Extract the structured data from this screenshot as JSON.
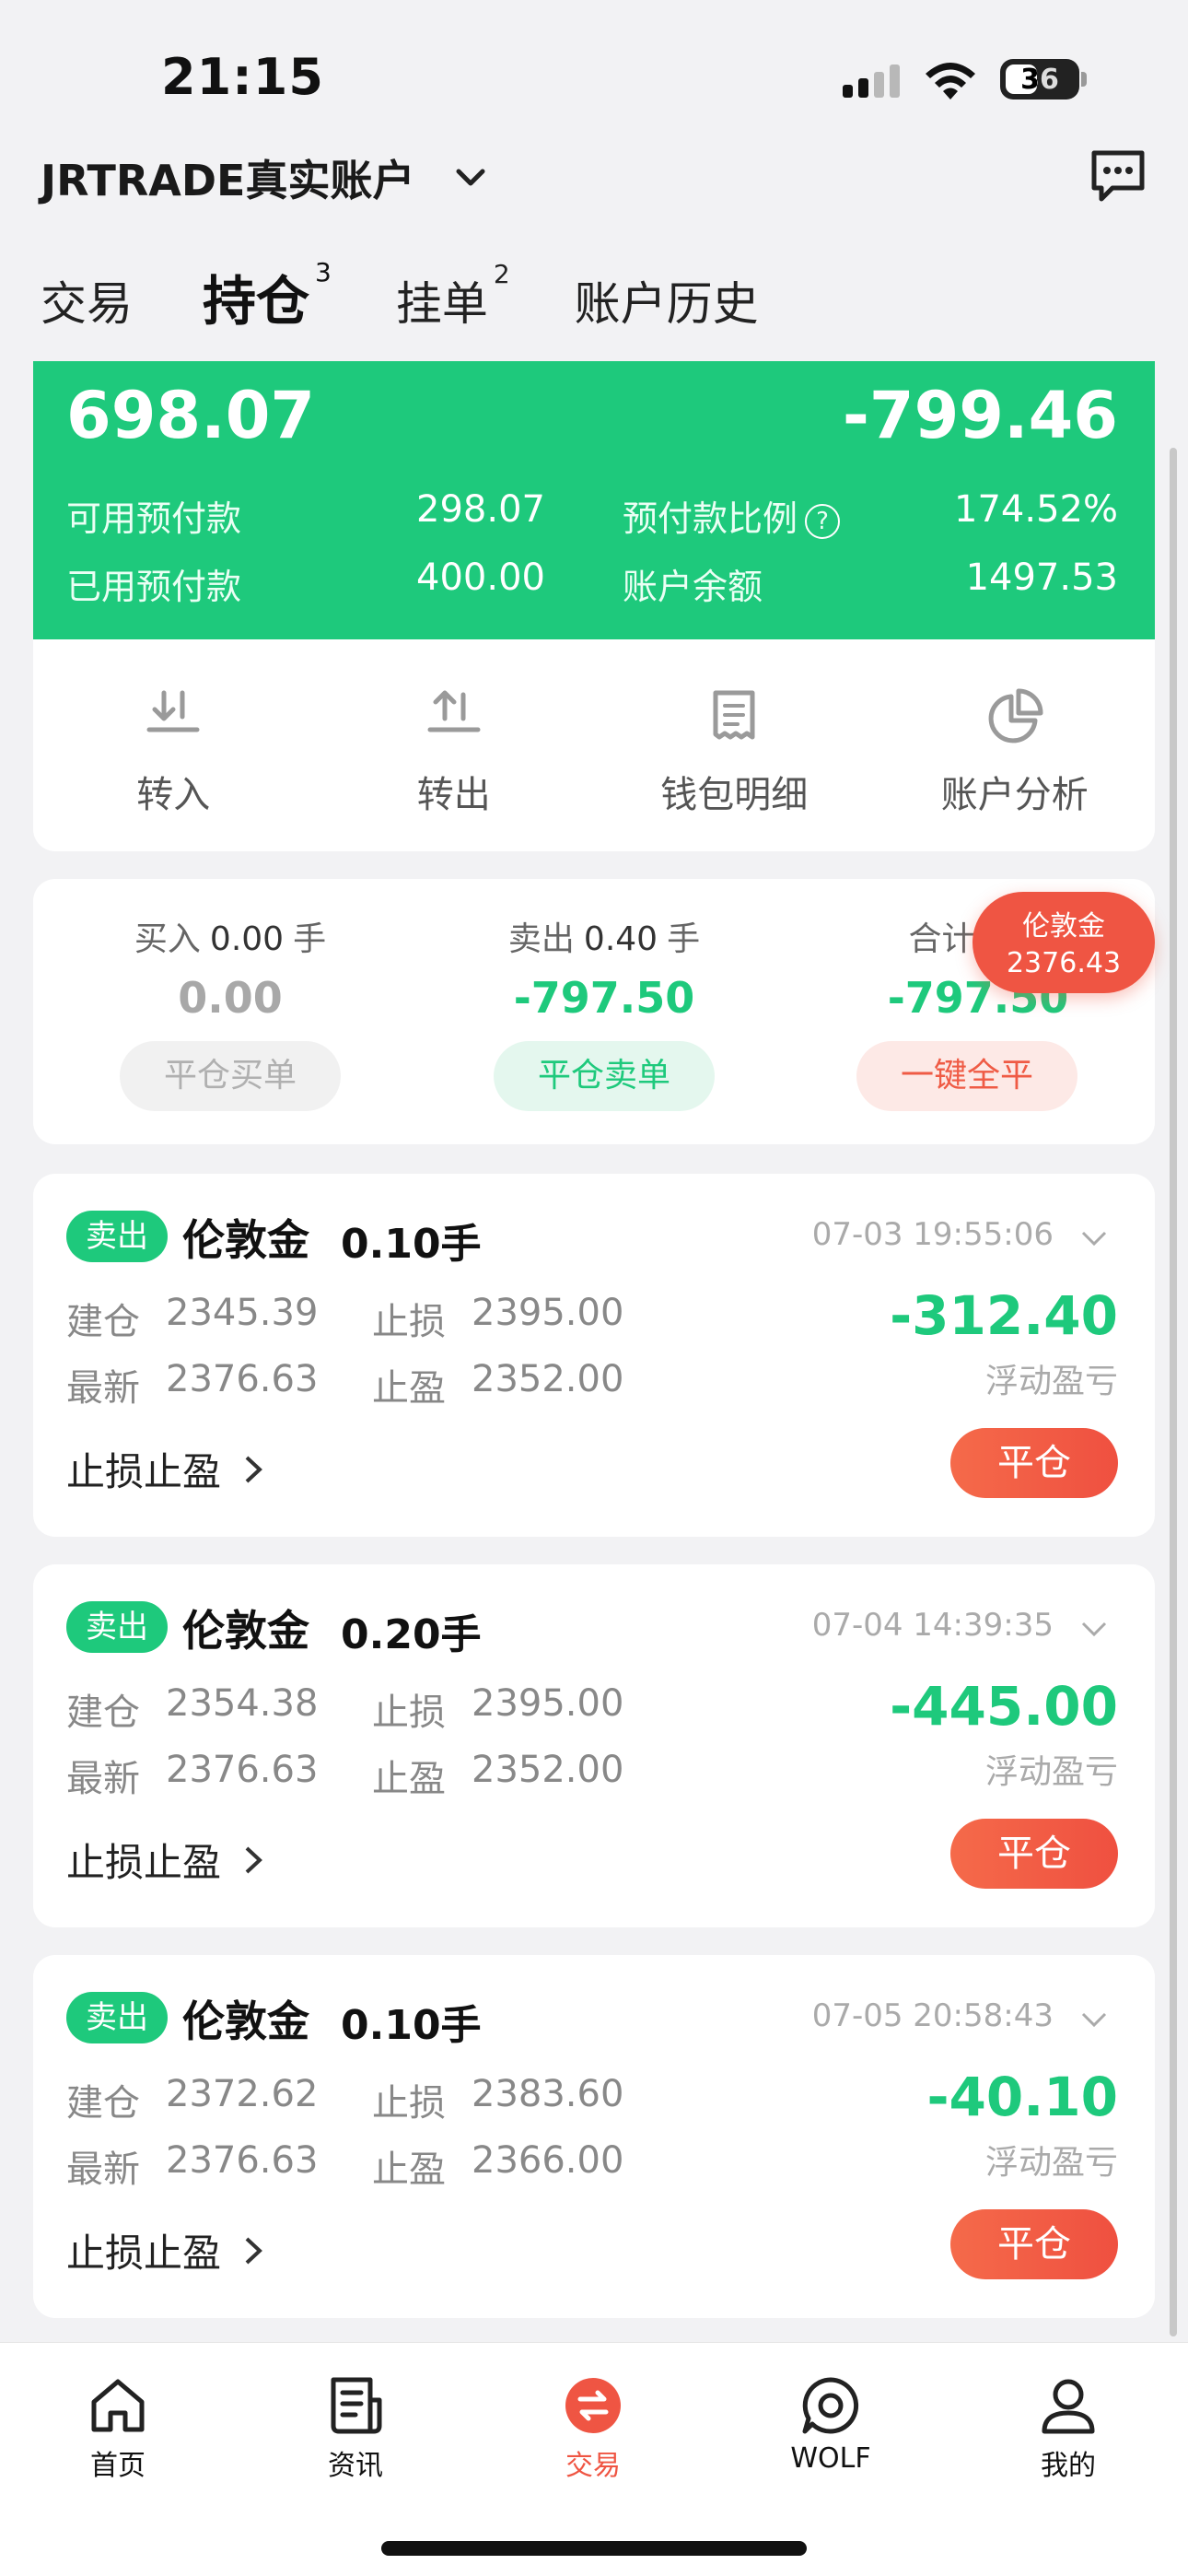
{
  "status_bar": {
    "time": "21:15",
    "battery": "36"
  },
  "header": {
    "account_name": "JRTRADE真实账户"
  },
  "tabs": [
    {
      "label": "交易",
      "count": ""
    },
    {
      "label": "持仓",
      "count": "3"
    },
    {
      "label": "挂单",
      "count": "2"
    },
    {
      "label": "账户历史",
      "count": ""
    }
  ],
  "summary": {
    "equity": "698.07",
    "floating_pl": "-799.46",
    "available_margin_label": "可用预付款",
    "available_margin": "298.07",
    "margin_ratio_label": "预付款比例",
    "margin_ratio": "174.52%",
    "used_margin_label": "已用预付款",
    "used_margin": "400.00",
    "balance_label": "账户余额",
    "balance": "1497.53",
    "help_icon": "?"
  },
  "actions": [
    {
      "label": "转入",
      "icon": "deposit-icon"
    },
    {
      "label": "转出",
      "icon": "withdraw-icon"
    },
    {
      "label": "钱包明细",
      "icon": "wallet-detail-icon"
    },
    {
      "label": "账户分析",
      "icon": "pie-chart-icon"
    }
  ],
  "totals": {
    "buy_label": "买入",
    "buy_lots": "0.00",
    "lots_unit": "手",
    "buy_amount": "0.00",
    "sell_label": "卖出",
    "sell_lots": "0.40",
    "sell_amount": "-797.50",
    "total_label": "合计",
    "total_lots": "0",
    "total_amount": "-797.50",
    "close_buy": "平仓买单",
    "close_sell": "平仓卖单",
    "close_all": "一键全平"
  },
  "price_badge": {
    "name": "伦敦金",
    "price": "2376.43"
  },
  "positions": [
    {
      "side": "卖出",
      "symbol": "伦敦金",
      "lots": "0.10手",
      "time": "07-03 19:55:06",
      "open_label": "建仓",
      "open": "2345.39",
      "sl_label": "止损",
      "sl": "2395.00",
      "last_label": "最新",
      "last": "2376.63",
      "tp_label": "止盈",
      "tp": "2352.00",
      "pl": "-312.40",
      "pl_label": "浮动盈亏",
      "sltp_link": "止损止盈",
      "close": "平仓"
    },
    {
      "side": "卖出",
      "symbol": "伦敦金",
      "lots": "0.20手",
      "time": "07-04 14:39:35",
      "open_label": "建仓",
      "open": "2354.38",
      "sl_label": "止损",
      "sl": "2395.00",
      "last_label": "最新",
      "last": "2376.63",
      "tp_label": "止盈",
      "tp": "2352.00",
      "pl": "-445.00",
      "pl_label": "浮动盈亏",
      "sltp_link": "止损止盈",
      "close": "平仓"
    },
    {
      "side": "卖出",
      "symbol": "伦敦金",
      "lots": "0.10手",
      "time": "07-05 20:58:43",
      "open_label": "建仓",
      "open": "2372.62",
      "sl_label": "止损",
      "sl": "2383.60",
      "last_label": "最新",
      "last": "2376.63",
      "tp_label": "止盈",
      "tp": "2366.00",
      "pl": "-40.10",
      "pl_label": "浮动盈亏",
      "sltp_link": "止损止盈",
      "close": "平仓"
    }
  ],
  "bottom_nav": [
    {
      "label": "首页",
      "icon": "home-icon"
    },
    {
      "label": "资讯",
      "icon": "news-icon"
    },
    {
      "label": "交易",
      "icon": "trade-icon",
      "active": true
    },
    {
      "label": "WOLF",
      "icon": "chat-bubble-icon"
    },
    {
      "label": "我的",
      "icon": "user-icon"
    }
  ],
  "colors": {
    "green": "#1ec97c",
    "red": "#ef5543",
    "background": "#f2f2f4"
  }
}
